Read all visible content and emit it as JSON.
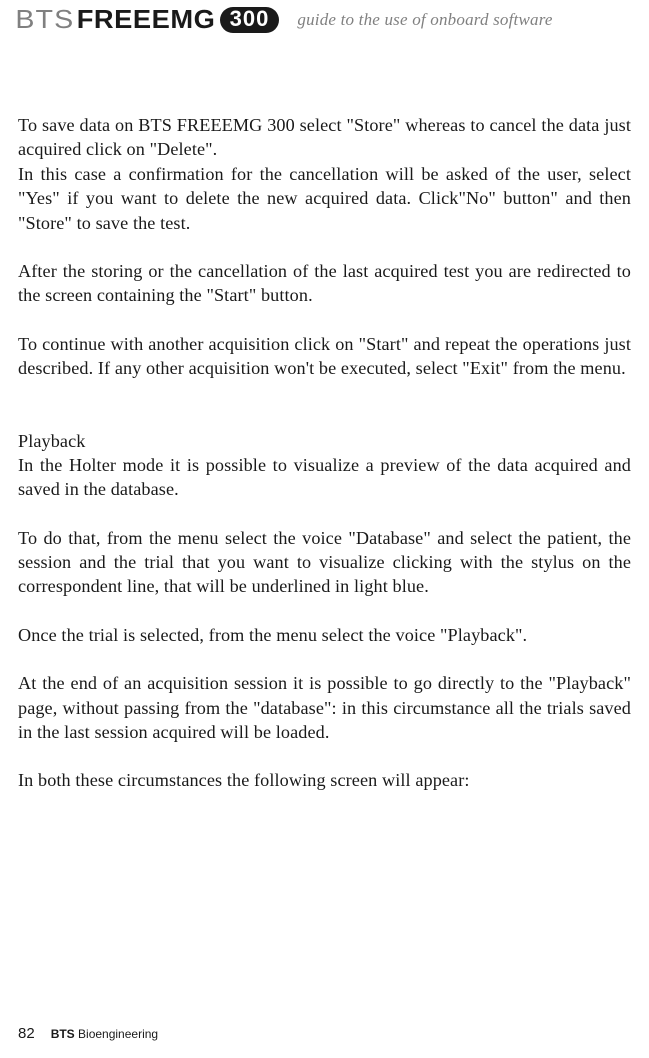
{
  "header": {
    "logo_bts": "BTS",
    "logo_freeemg": "FREEEMG",
    "badge": "300",
    "subtitle": "guide to the use of onboard software"
  },
  "body": {
    "p1": "To save data on BTS FREEEMG 300 select \"Store\" whereas to cancel the data just acquired click on \"Delete\".",
    "p2": "In this case a confirmation for the cancellation will be asked of the user, select \"Yes\" if you want to delete the new acquired data. Click\"No\" button\" and then \"Store\" to save the test.",
    "p3": "After the storing or the cancellation of the last acquired test you are redirected  to the screen containing the \"Start\" button.",
    "p4": "To continue with another acquisition click on \"Start\" and repeat the operations just described. If any other acquisition won't be executed, select \"Exit\" from the menu.",
    "section_playback": "Playback",
    "p5": "In the Holter mode it is possible to visualize a preview of the data acquired and saved in the database.",
    "p6": "To do that, from the menu select the voice \"Database\" and select the patient, the session and the trial that you want to visualize clicking with the stylus on the correspondent line, that will be underlined in light blue.",
    "p7": "Once the trial is selected, from the menu select the voice \"Playback\".",
    "p8": "At the end of an acquisition session it is possible to go directly to the \"Playback\" page, without passing from the \"database\": in this circumstance all the trials saved in the last session acquired will be loaded.",
    "p9": "In both these circumstances the following screen will appear:"
  },
  "footer": {
    "page": "82",
    "brand_bold": "BTS",
    "brand_rest": " Bioengineering"
  }
}
